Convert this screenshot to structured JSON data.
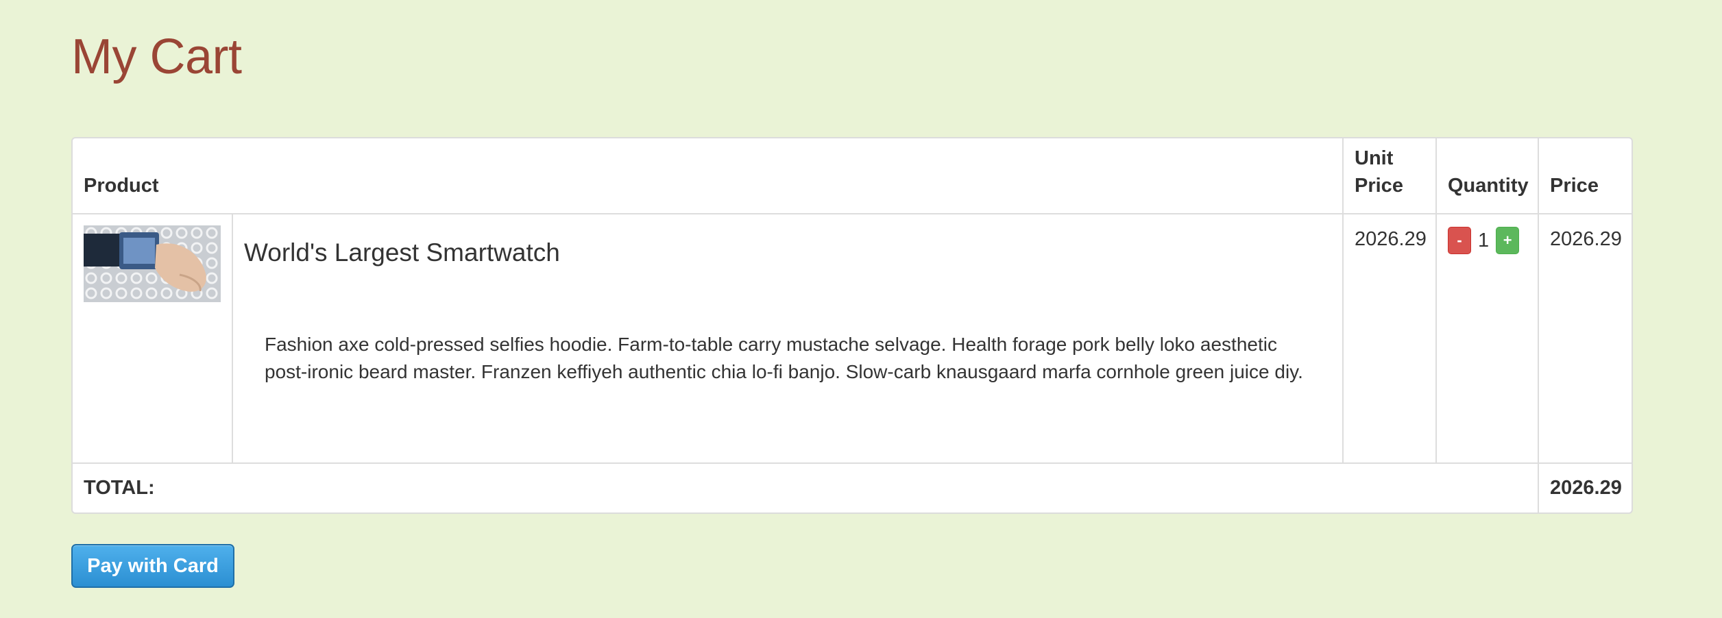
{
  "page": {
    "title": "My Cart"
  },
  "table": {
    "headers": {
      "product": "Product",
      "unit_price": "Unit Price",
      "quantity": "Quantity",
      "price": "Price"
    },
    "items": [
      {
        "name": "World's Largest Smartwatch",
        "description": "Fashion axe cold-pressed selfies hoodie. Farm-to-table carry mustache selvage. Health forage pork belly loko aesthetic post-ironic beard master. Franzen keffiyeh authentic chia lo-fi banjo. Slow-carb knausgaard marfa cornhole green juice diy.",
        "unit_price": "2026.29",
        "quantity": "1",
        "price": "2026.29",
        "decrement_label": "-",
        "increment_label": "+"
      }
    ],
    "total_label": "TOTAL:",
    "total_value": "2026.29"
  },
  "actions": {
    "pay_label": "Pay with Card"
  },
  "colors": {
    "background": "#eaf3d6",
    "title": "#9a4535",
    "decrement": "#d9534f",
    "increment": "#5cb85c",
    "pay_button": "#2b8fd2"
  }
}
